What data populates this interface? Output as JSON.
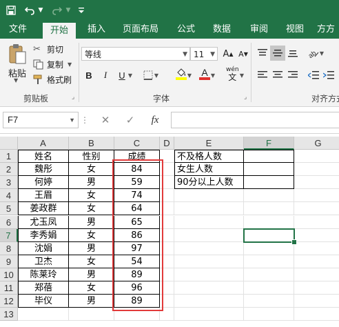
{
  "title_bar": {
    "icons": [
      "save-icon",
      "undo-icon",
      "undo-dropdown-icon",
      "redo-icon",
      "redo-dropdown-icon",
      "customize-quick-access-icon"
    ]
  },
  "tabs": [
    {
      "label": "文件"
    },
    {
      "label": "开始",
      "active": true
    },
    {
      "label": "插入"
    },
    {
      "label": "页面布局"
    },
    {
      "label": "公式"
    },
    {
      "label": "数据"
    },
    {
      "label": "审阅"
    },
    {
      "label": "视图"
    },
    {
      "label": "方方"
    }
  ],
  "ribbon": {
    "paste_label": "粘贴",
    "cut_label": "剪切",
    "copy_label": "复制",
    "format_painter_label": "格式刷",
    "clipboard_group": "剪贴板",
    "font_name": "等线",
    "font_size": "11",
    "font_group": "字体",
    "bold": "B",
    "italic": "I",
    "underline": "U",
    "wen_label": "wén",
    "wen_char": "文",
    "align_group": "对齐方式",
    "accent_color": "#217346",
    "highlight_color": "#ffff00"
  },
  "formula_bar": {
    "name_box": "F7",
    "fx_label": "fx",
    "formula_value": ""
  },
  "sheet": {
    "columns": [
      "A",
      "B",
      "C",
      "D",
      "E",
      "F",
      "G"
    ],
    "rows": [
      "1",
      "2",
      "3",
      "4",
      "5",
      "6",
      "7",
      "8",
      "9",
      "10",
      "11",
      "12",
      "13"
    ],
    "headers": {
      "name": "姓名",
      "gender": "性别",
      "score": "成绩"
    },
    "records": [
      {
        "name": "魏彤",
        "gender": "女",
        "score": "84"
      },
      {
        "name": "何婷",
        "gender": "男",
        "score": "59"
      },
      {
        "name": "王眉",
        "gender": "女",
        "score": "74"
      },
      {
        "name": "姜政群",
        "gender": "女",
        "score": "64"
      },
      {
        "name": "尤玉凤",
        "gender": "男",
        "score": "65"
      },
      {
        "name": "李秀娟",
        "gender": "女",
        "score": "86"
      },
      {
        "name": "沈娟",
        "gender": "男",
        "score": "97"
      },
      {
        "name": "卫杰",
        "gender": "女",
        "score": "54"
      },
      {
        "name": "陈莱玲",
        "gender": "男",
        "score": "89"
      },
      {
        "name": "郑蓓",
        "gender": "女",
        "score": "96"
      },
      {
        "name": "毕仪",
        "gender": "男",
        "score": "89"
      }
    ],
    "summary": [
      "不及格人数",
      "女生人数",
      "90分以上人数"
    ],
    "active_cell": "F7",
    "highlight_color": "#e23a3a"
  }
}
